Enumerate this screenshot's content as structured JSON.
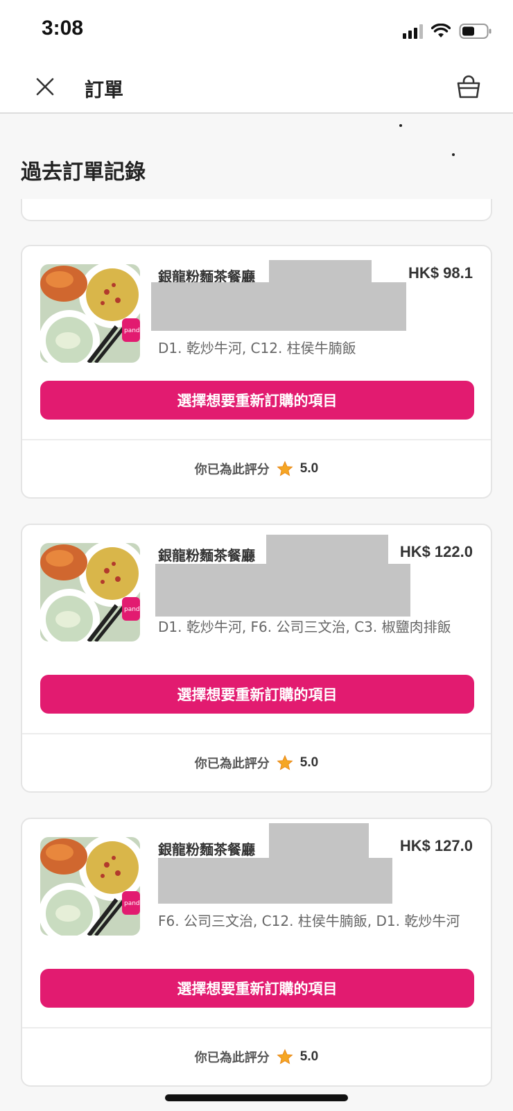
{
  "status_bar": {
    "time": "3:08"
  },
  "header": {
    "title": "訂單",
    "close_icon": "close-icon",
    "bag_icon": "shopping-bag-icon"
  },
  "section_title": "過去訂單記錄",
  "orders": [
    {
      "restaurant": "銀龍粉麵茶餐廳",
      "price": "HK$ 98.1",
      "items": "D1. 乾炒牛河, C12. 柱侯牛腩飯",
      "reorder_label": "選擇想要重新訂購的項目",
      "rating_label": "你已為此評分",
      "rating_value": "5.0"
    },
    {
      "restaurant": "銀龍粉麵茶餐廳",
      "price": "HK$ 122.0",
      "items": "D1. 乾炒牛河, F6. 公司三文治, C3. 椒鹽肉排飯",
      "reorder_label": "選擇想要重新訂購的項目",
      "rating_label": "你已為此評分",
      "rating_value": "5.0"
    },
    {
      "restaurant": "銀龍粉麵茶餐廳",
      "price": "HK$ 127.0",
      "items": "F6. 公司三文治, C12. 柱侯牛腩飯, D1. 乾炒牛河",
      "reorder_label": "選擇想要重新訂購的項目",
      "rating_label": "你已為此評分",
      "rating_value": "5.0"
    }
  ],
  "colors": {
    "accent": "#e21b70",
    "star": "#f5a623"
  }
}
